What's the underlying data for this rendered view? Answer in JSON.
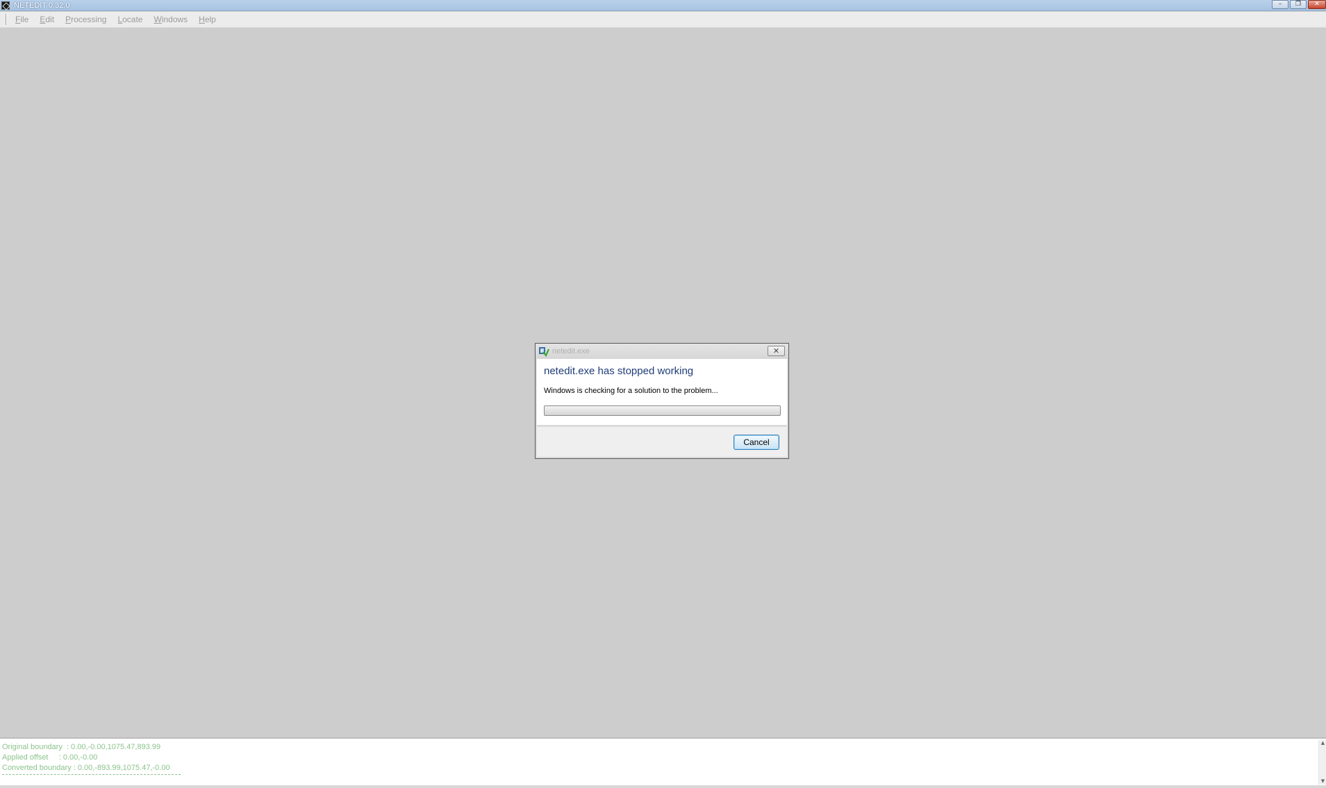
{
  "window": {
    "title": "NETEDIT 0.32.0",
    "minimize_label": "–",
    "restore_label": "❐",
    "close_label": "✕"
  },
  "menu": {
    "items": [
      "File",
      "Edit",
      "Processing",
      "Locate",
      "Windows",
      "Help"
    ]
  },
  "dialog": {
    "title": "netedit.exe",
    "heading": "netedit.exe has stopped working",
    "message": "Windows is checking for a solution to the problem...",
    "close_label": "✕",
    "cancel_label": "Cancel",
    "progress_percent": 0
  },
  "log": {
    "lines": [
      "Original boundary  : 0.00,-0.00,1075.47,893.99",
      "Applied offset     : 0.00,-0.00",
      "Converted boundary : 0.00,-893.99,1075.47,-0.00"
    ]
  },
  "colors": {
    "log_text": "#8bc38b",
    "dialog_heading": "#1e3c78",
    "workspace": "#cdcdcd"
  }
}
